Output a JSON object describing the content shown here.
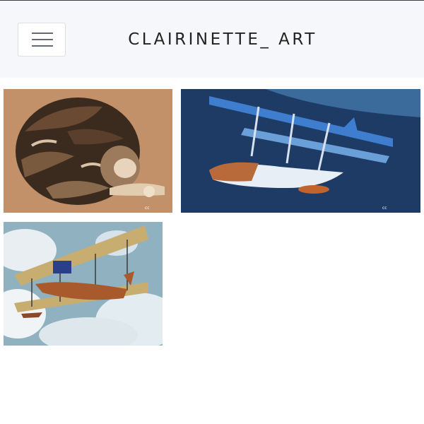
{
  "header": {
    "brand": "CLAIRINETTE_ ART",
    "menu_icon": "hamburger-menu-icon"
  },
  "gallery": {
    "items": [
      {
        "subject": "sleeping tabby cat",
        "watermark": "cc"
      },
      {
        "subject": "seaplane biplane on water",
        "watermark": "cc"
      },
      {
        "subject": "biplane flying boat in clouds",
        "watermark": ""
      }
    ]
  },
  "colors": {
    "header_bg": "#f5f7fa",
    "cat_bg": "#c2916a",
    "seaplane_bg": "#1e3b66",
    "sky_bg": "#8fb1c0"
  }
}
